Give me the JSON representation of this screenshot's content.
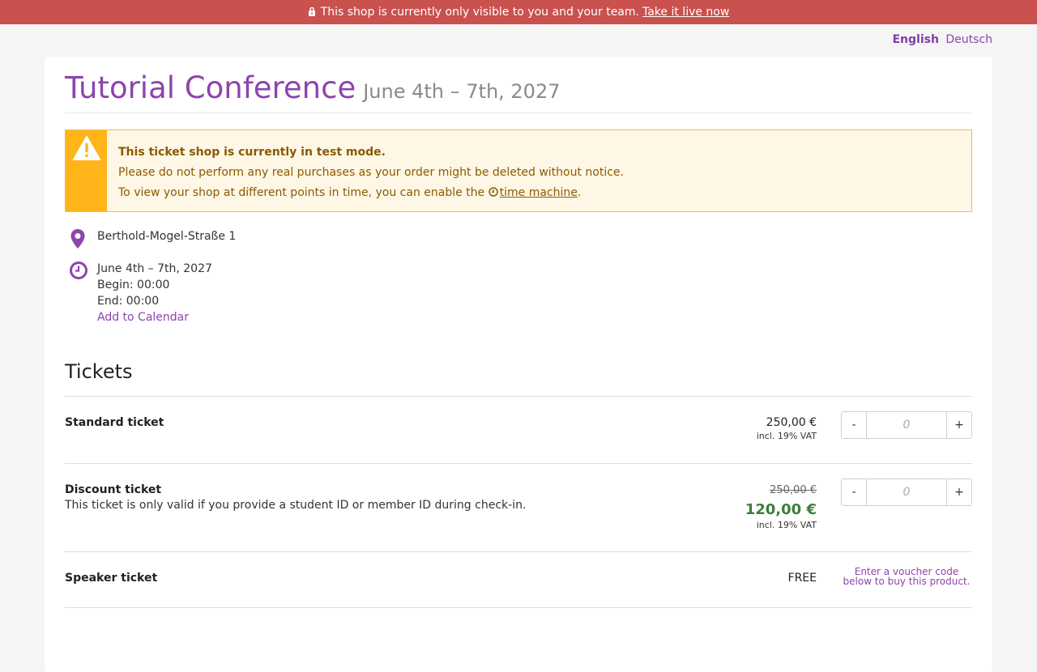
{
  "banner": {
    "text": "This shop is currently only visible to you and your team.",
    "link": "Take it live now"
  },
  "languages": {
    "active": "English",
    "other": "Deutsch"
  },
  "event": {
    "title": "Tutorial Conference",
    "dates": "June 4th – 7th, 2027"
  },
  "alert": {
    "title": "This ticket shop is currently in test mode.",
    "line2": "Please do not perform any real purchases as your order might be deleted without notice.",
    "line3_prefix": "To view your shop at different points in time, you can enable the",
    "line3_link": "time machine",
    "line3_suffix": "."
  },
  "location": {
    "address": "Berthold-Mogel-Straße 1"
  },
  "schedule": {
    "dates": "June 4th – 7th, 2027",
    "begin": "Begin: 00:00",
    "end": "End: 00:00",
    "calendar_link": "Add to Calendar"
  },
  "tickets": {
    "heading": "Tickets",
    "items": [
      {
        "name": "Standard ticket",
        "price": "250,00 €",
        "vat": "incl. 19% VAT",
        "qty_placeholder": "0",
        "minus": "-",
        "plus": "+"
      },
      {
        "name": "Discount ticket",
        "description": "This ticket is only valid if you provide a student ID or member ID during check-in.",
        "old_price": "250,00 €",
        "price": "120,00 €",
        "vat": "incl. 19% VAT",
        "qty_placeholder": "0",
        "minus": "-",
        "plus": "+"
      },
      {
        "name": "Speaker ticket",
        "price": "FREE",
        "voucher_note": "Enter a voucher code below to buy this product."
      }
    ]
  },
  "colors": {
    "brand": "#8e44ad",
    "banner": "#c9514e",
    "warning": "#ffb419",
    "discount_price": "#3b7f3b"
  }
}
